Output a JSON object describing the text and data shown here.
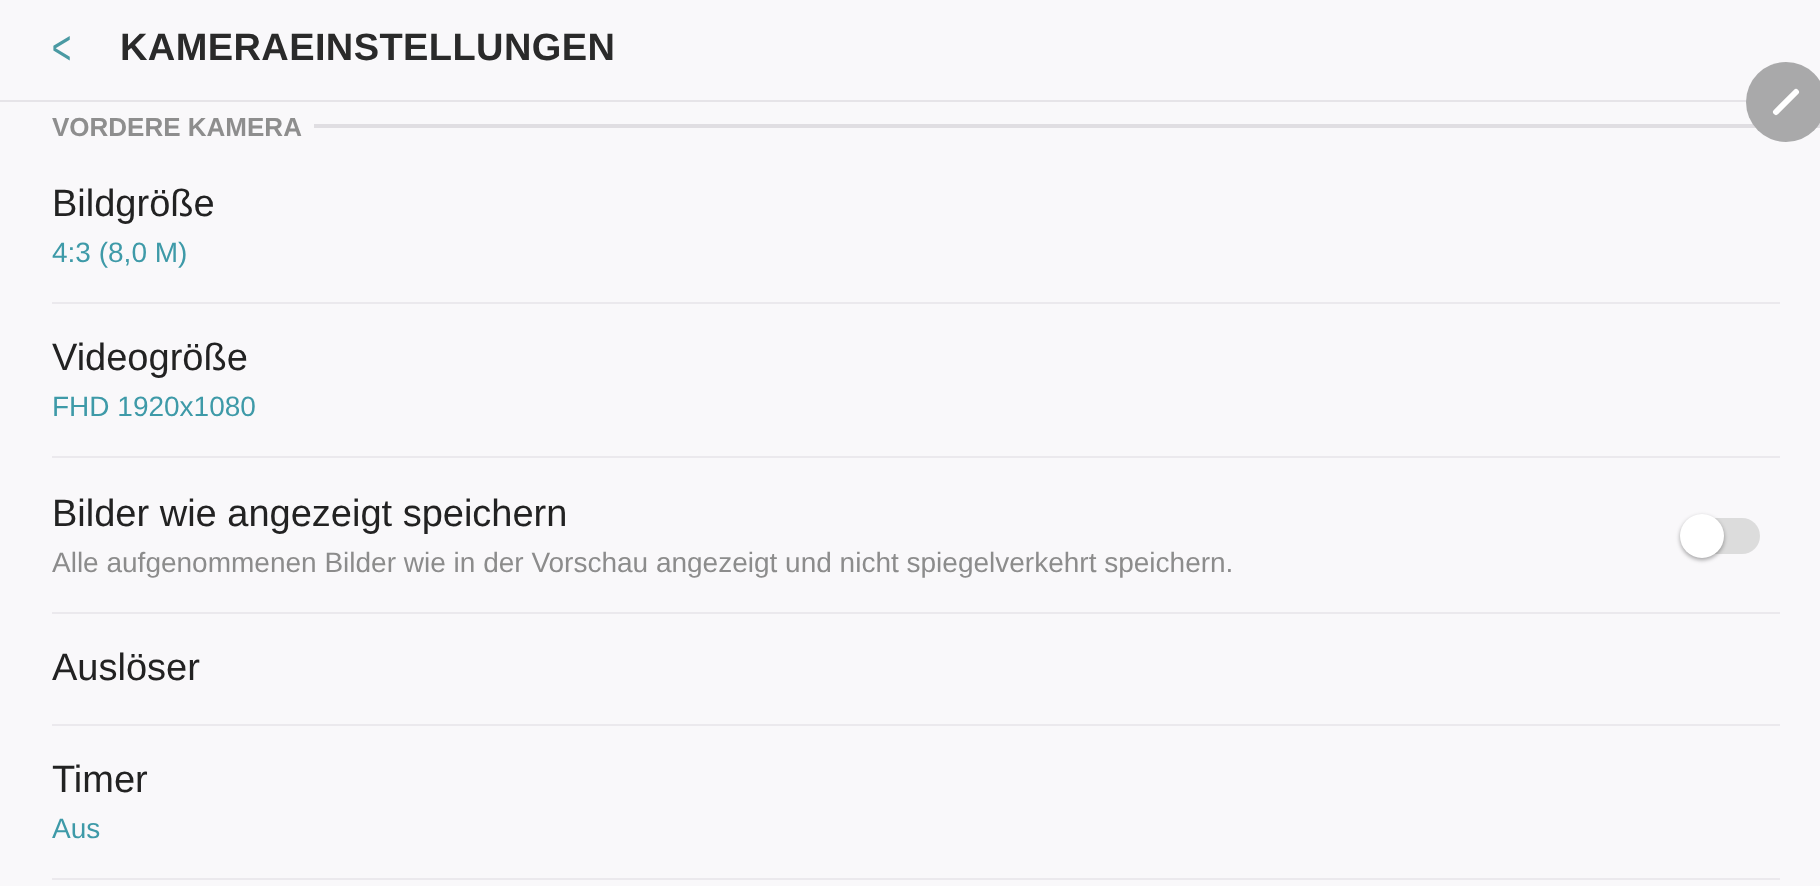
{
  "header": {
    "back": "<",
    "title": "KAMERAEINSTELLUNGEN"
  },
  "section": {
    "title": "VORDERE KAMERA"
  },
  "items": [
    {
      "kind": "value",
      "title": "Bildgröße",
      "value": "4:3 (8,0 M)"
    },
    {
      "kind": "value",
      "title": "Videogröße",
      "value": "FHD 1920x1080"
    },
    {
      "kind": "toggle",
      "title": "Bilder wie angezeigt speichern",
      "description": "Alle aufgenommenen Bilder wie in der Vorschau angezeigt und nicht spiegelverkehrt speichern.",
      "on": false
    },
    {
      "kind": "plain",
      "title": "Auslöser"
    },
    {
      "kind": "value",
      "title": "Timer",
      "value": "Aus"
    }
  ]
}
